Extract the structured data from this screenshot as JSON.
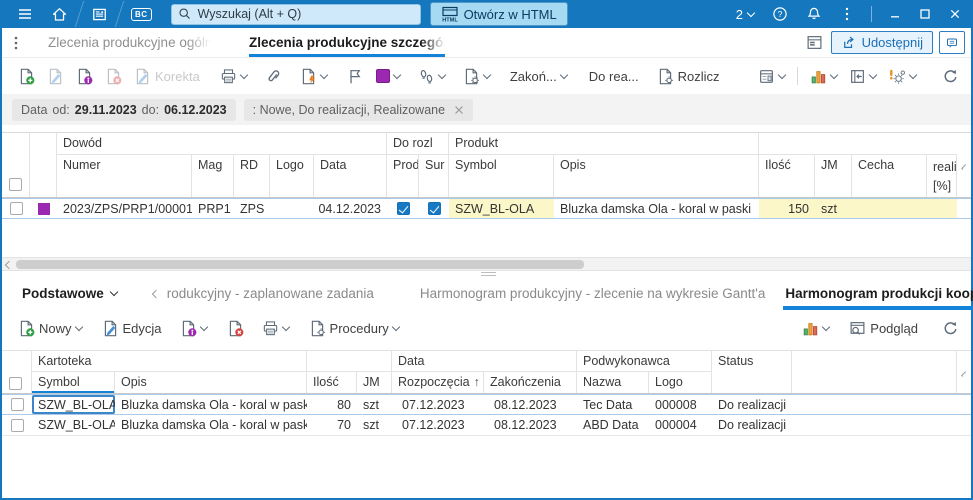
{
  "colors": {
    "accent": "#1283d8",
    "titlebar_blue": "#1577bd",
    "highlight_yellow": "#fbf7c9",
    "row_marker_purple": "#9c27b0"
  },
  "titlebar": {
    "bc_badge": "BC",
    "search_placeholder": "Wyszukaj (Alt + Q)",
    "html_badge": "HTML",
    "open_html_label": "Otwórz w HTML",
    "notification_count": "2"
  },
  "tabs_top": {
    "tab1": "Zlecenia produkcyjne ogólne",
    "tab2": "Zlecenia produkcyjne szczegółowe",
    "share_label": "Udostępnij"
  },
  "toolbar1": {
    "korekta_label": "Korekta",
    "zakoncz_label": "Zakoń...",
    "dorea_label": "Do rea...",
    "rozlicz_label": "Rozlicz"
  },
  "filters": {
    "data_label": "Data",
    "od_label": "od:",
    "od_value": "29.11.2023",
    "do_label": "do:",
    "do_value": "06.12.2023",
    "status_filter": ": Nowe, Do realizacji, Realizowane"
  },
  "grid1": {
    "group_dowod": "Dowód",
    "group_dorozl": "Do rozl",
    "group_produkt": "Produkt",
    "col_numer": "Numer",
    "col_mag": "Mag",
    "col_rd": "RD",
    "col_logo": "Logo",
    "col_data": "Data",
    "col_prod": "Prod",
    "col_sur": "Sur",
    "col_symbol": "Symbol",
    "col_opis": "Opis",
    "col_ilosc": "Ilość",
    "col_jm": "JM",
    "col_cecha": "Cecha",
    "col_realiz_line1": "realiz",
    "col_realiz_line2": "[%]",
    "rows": [
      {
        "numer": "2023/ZPS/PRP1/00001",
        "mag": "PRP1",
        "rd": "ZPS",
        "logo": "",
        "data": "04.12.2023",
        "prod": "checked",
        "sur": "checked",
        "symbol": "SZW_BL-OLA",
        "opis": "Bluzka damska Ola - koral w paski",
        "ilosc": "150",
        "jm": "szt",
        "cecha": "",
        "realiz": ""
      }
    ]
  },
  "tabs_bottom": {
    "podstawowe_label": "Podstawowe",
    "tab1": "rodukcyjny - zaplanowane zadania",
    "tab2": "Harmonogram produkcyjny - zlecenie na wykresie Gantt'a",
    "tab3": "Harmonogram produkcji kooperanta"
  },
  "toolbar2": {
    "nowy_label": "Nowy",
    "edycja_label": "Edycja",
    "procedury_label": "Procedury",
    "podglad_label": "Podgląd"
  },
  "grid2": {
    "group_kartoteka": "Kartoteka",
    "group_data": "Data",
    "group_podwykonawca": "Podwykonawca",
    "group_status": "Status",
    "col_symbol": "Symbol",
    "col_opis": "Opis",
    "col_ilosc": "Ilość",
    "col_jm": "JM",
    "col_rozpoczecia": "Rozpoczęcia",
    "sort_arrow": "↑",
    "col_zakonczenia": "Zakończenia",
    "col_nazwa": "Nazwa",
    "col_logo": "Logo",
    "rows": [
      {
        "symbol": "SZW_BL-OLA",
        "opis": "Bluzka damska Ola - koral w paski",
        "ilosc": "80",
        "jm": "szt",
        "rozpoczecia": "07.12.2023",
        "zakonczenia": "08.12.2023",
        "nazwa": "Tec Data",
        "logo": "000008",
        "status": "Do realizacji"
      },
      {
        "symbol": "SZW_BL-OLA",
        "opis": "Bluzka damska Ola - koral w paski",
        "ilosc": "70",
        "jm": "szt",
        "rozpoczecia": "07.12.2023",
        "zakonczenia": "08.12.2023",
        "nazwa": "ABD Data",
        "logo": "000004",
        "status": "Do realizacji"
      }
    ]
  }
}
